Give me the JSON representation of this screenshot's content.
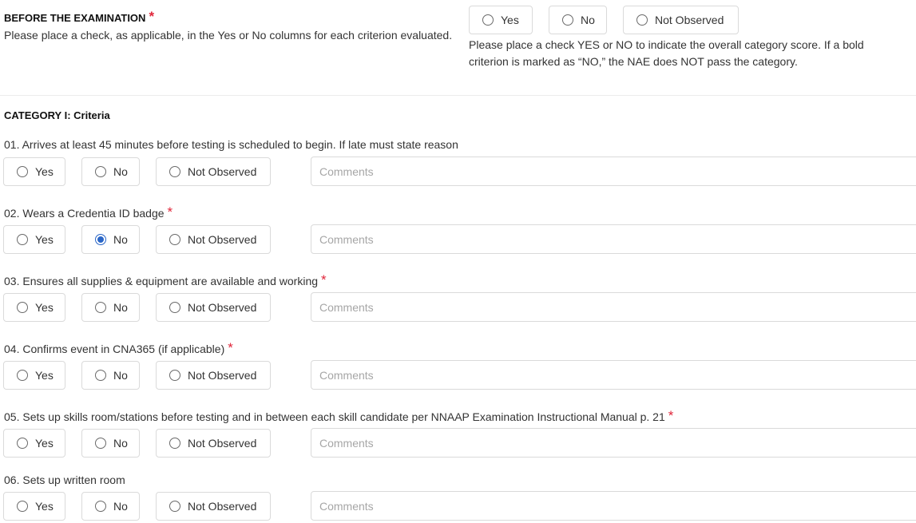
{
  "section": {
    "title": "BEFORE THE EXAMINATION",
    "required_mark": "*",
    "description": "Please place a check, as applicable, in the Yes or No columns for each criterion evaluated.",
    "overall_options": {
      "yes": "Yes",
      "no": "No",
      "not_observed": "Not Observed"
    },
    "overall_selected": null,
    "overall_note": "Please place a check YES or NO to indicate the overall category score. If a bold criterion is marked as “NO,” the NAE does NOT pass the category."
  },
  "category": {
    "title": "CATEGORY I: Criteria"
  },
  "options": {
    "yes": "Yes",
    "no": "No",
    "not_observed": "Not Observed"
  },
  "comments_placeholder": "Comments",
  "criteria": [
    {
      "label": "01. Arrives at least 45 minutes before testing is scheduled to begin. If late must state reason",
      "required": false,
      "selected": null
    },
    {
      "label": "02. Wears a Credentia ID badge",
      "required": true,
      "selected": "no"
    },
    {
      "label": "03. Ensures all supplies & equipment are available and working",
      "required": true,
      "selected": null
    },
    {
      "label": "04. Confirms event in CNA365 (if applicable)",
      "required": true,
      "selected": null
    },
    {
      "label": "05. Sets up skills room/stations before testing and in between each skill candidate per NNAAP Examination Instructional Manual p. 21",
      "required": true,
      "selected": null
    },
    {
      "label": "06. Sets up written room",
      "required": false,
      "selected": null
    }
  ],
  "colors": {
    "required": "#e0263a",
    "radio_checked": "#2a66c7",
    "border": "#dadada"
  }
}
